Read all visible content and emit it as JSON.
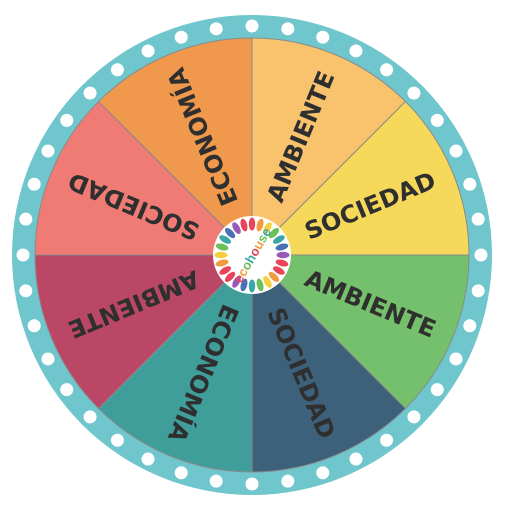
{
  "wheel": {
    "rim_color": "#6fc6cc",
    "dot_color": "#ffffff",
    "divider_color": "#8a8a8a",
    "segments": [
      {
        "label": "AMBIENTE",
        "color": "#f9c36d"
      },
      {
        "label": "SOCIEDAD",
        "color": "#f6d95a"
      },
      {
        "label": "AMBIENTE",
        "color": "#74c06d"
      },
      {
        "label": "SOCIEDAD",
        "color": "#3d617a"
      },
      {
        "label": "ECONOMÍA",
        "color": "#3f9d9a"
      },
      {
        "label": "AMBIENTE",
        "color": "#bb4766"
      },
      {
        "label": "SOCIEDAD",
        "color": "#ef7b74"
      },
      {
        "label": "ECONOMÍA",
        "color": "#f0994c"
      }
    ]
  },
  "logo": {
    "text": "ecohouse",
    "letter_colors": [
      "#e8455b",
      "#f19a3e",
      "#6cbf5a",
      "#3aa6a6",
      "#e8455b",
      "#f19a3e",
      "#6cbf5a",
      "#3aa6a6"
    ],
    "petal_colors": [
      "#e8455b",
      "#f19a3e",
      "#f4d03f",
      "#6cbf5a",
      "#3aa6a6",
      "#4b6fb3",
      "#9b59b6",
      "#e8455b"
    ]
  }
}
